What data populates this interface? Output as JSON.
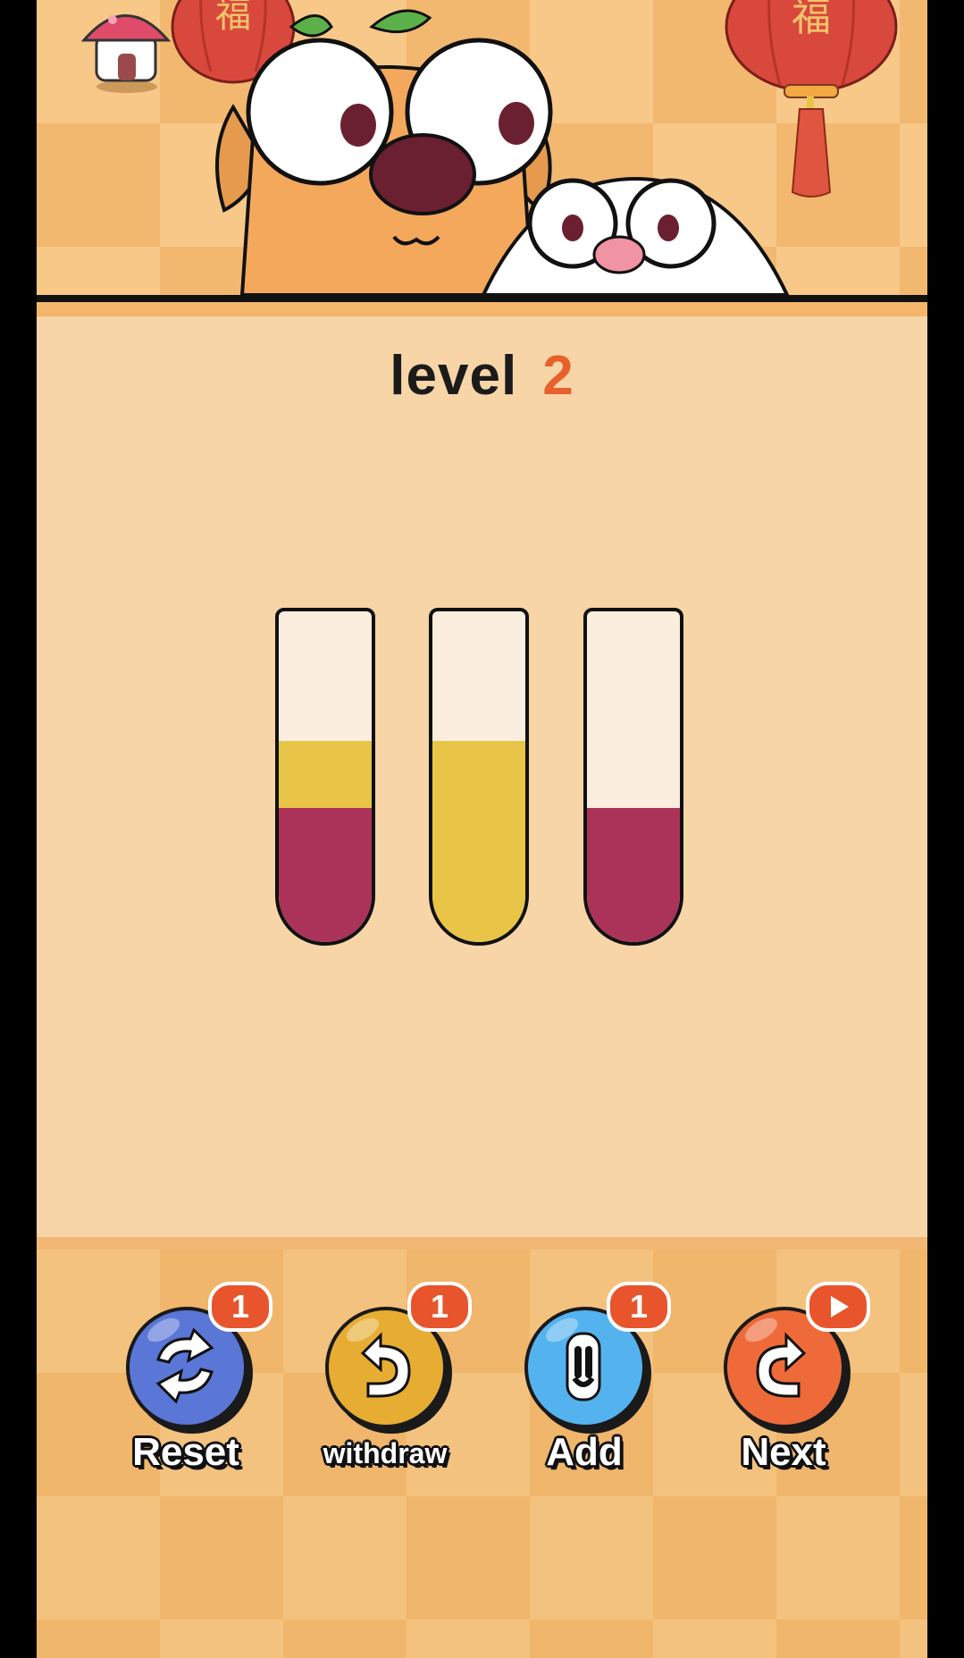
{
  "level": {
    "word": "level",
    "number": "2"
  },
  "tubes": [
    {
      "layers": [
        {
          "color": "#e8c547",
          "units": 1
        },
        {
          "color": "#ab3258",
          "units": 2
        }
      ]
    },
    {
      "layers": [
        {
          "color": "#e8c547",
          "units": 3
        }
      ]
    },
    {
      "layers": [
        {
          "color": "#ab3258",
          "units": 2
        }
      ]
    }
  ],
  "tube_capacity_units": 6,
  "buttons": {
    "reset": {
      "label": "Reset",
      "badge": "1",
      "icon": "refresh-icon",
      "color": "#5a76d6"
    },
    "withdraw": {
      "label": "withdraw",
      "badge": "1",
      "icon": "undo-icon",
      "color": "#e7ad33"
    },
    "add": {
      "label": "Add",
      "badge": "1",
      "icon": "test-tube-icon",
      "color": "#54b3ef"
    },
    "next": {
      "label": "Next",
      "badge_icon": "play-icon",
      "icon": "redo-icon",
      "color": "#ee6b39"
    }
  },
  "colors": {
    "liquid_yellow": "#e8c547",
    "liquid_red": "#ab3258",
    "level_number": "#e8602c",
    "badge": "#e8552d"
  }
}
